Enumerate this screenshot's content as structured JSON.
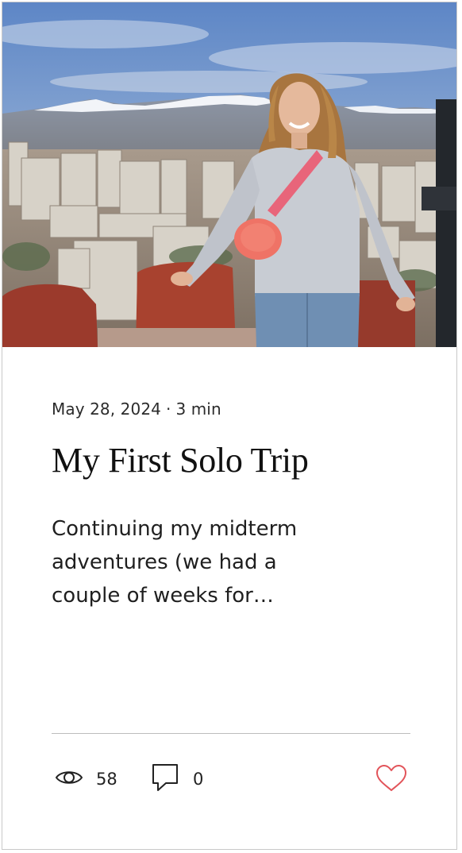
{
  "post": {
    "image_description": "Woman in grey sweater and jeans with a pink crossbody bag standing on a terrace overlooking a city with snow-capped mountains",
    "date": "May 28, 2024",
    "separator": "·",
    "read_time": "3 min",
    "title": "My First Solo Trip",
    "excerpt": "Continuing my midterm adventures (we had a couple of weeks for…"
  },
  "stats": {
    "views": "58",
    "comments": "0"
  },
  "icons": {
    "views": "eye-icon",
    "comments": "comment-bubble-icon",
    "like": "heart-outline-icon"
  },
  "colors": {
    "like_heart": "#e2545a",
    "text_primary": "#111111",
    "divider": "#bdbdbd"
  }
}
